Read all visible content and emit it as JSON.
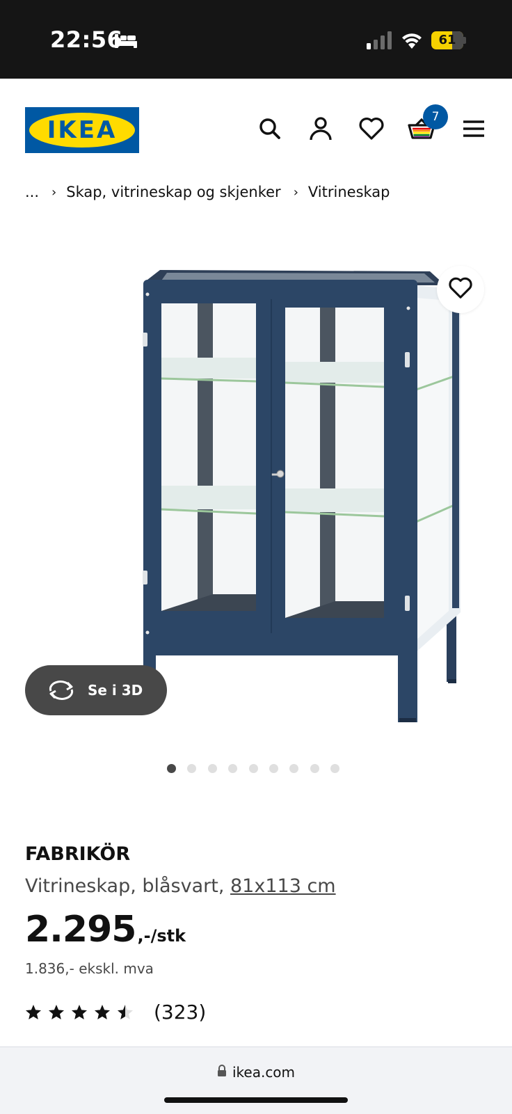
{
  "status_bar": {
    "time": "22:56",
    "battery": "61",
    "icons": [
      "bed-icon",
      "signal-icon",
      "wifi-icon",
      "battery-icon"
    ]
  },
  "header": {
    "logo": "IKEA",
    "icons": [
      "search-icon",
      "user-icon",
      "heart-icon",
      "cart-icon",
      "menu-icon"
    ],
    "cart_count": "7",
    "colors": {
      "brand_blue": "#0058a3",
      "brand_yellow": "#ffdb00"
    }
  },
  "breadcrumb": {
    "ellipsis": "...",
    "items": [
      "Skap, vitrineskap og skjenker",
      "Vitrineskap"
    ]
  },
  "gallery": {
    "see_3d_label": "Se i 3D",
    "image_count": 9,
    "active_index": 0
  },
  "product": {
    "name": "FABRIKÖR",
    "description": "Vitrineskap, blåsvart, ",
    "size": "81x113 cm",
    "price": "2.295",
    "price_suffix": ",-/stk",
    "price_ex_vat": "1.836,- ekskl. mva",
    "rating": 4.5,
    "rating_max": 5,
    "review_count": "(323)"
  },
  "browser": {
    "url": "ikea.com"
  }
}
